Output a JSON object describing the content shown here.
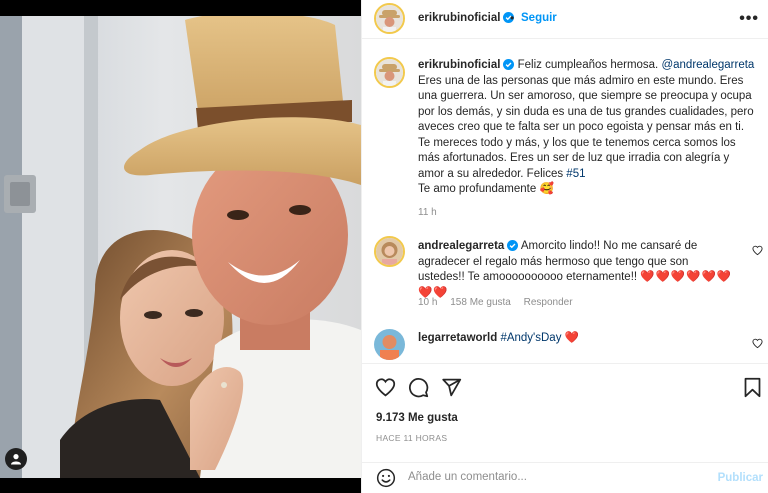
{
  "header": {
    "username": "erikrubinoficial",
    "dot": "•",
    "follow_label": "Seguir",
    "more_label": "•••"
  },
  "caption": {
    "username": "erikrubinoficial",
    "text_before_mention": "Feliz cumpleaños hermosa. ",
    "mention": "@andrealegarreta",
    "text_body": " Eres una de las personas que más admiro en este mundo. Eres una guerrera. Un ser amoroso, que siempre se preocupa y ocupa por los demás, y sin duda es una de tus grandes cualidades, pero aveces creo que te falta ser un poco egoista y pensar más en ti. Te mereces todo y más, y los que te tenemos cerca somos los más afortunados. Eres un ser de luz que irradia con alegría y amor a su alrededor. Felices ",
    "hashtag": "#51",
    "closing": "Te amo profundamente",
    "closing_emoji": "🥰",
    "time": "11 h"
  },
  "comments": [
    {
      "username": "andrealegarreta",
      "text": "Amorcito lindo!! No me cansaré de agradecer el regalo más hermoso que tengo que son ustedes!! Te amoooooooooo eternamente!!",
      "hearts": "❤️❤️❤️❤️❤️❤️❤️❤️",
      "time": "10 h",
      "likes": "158 Me gusta",
      "reply_label": "Responder"
    },
    {
      "username": "legarretaworld",
      "hashtag": "#Andy'sDay",
      "hearts": "❤️"
    }
  ],
  "actions": {
    "likes": "9.173 Me gusta",
    "ago": "HACE 11 HORAS"
  },
  "add_comment": {
    "placeholder": "Añade un comentario...",
    "publish_label": "Publicar"
  },
  "icons": [
    "verified-badge-icon",
    "heart-icon",
    "comment-icon",
    "share-icon",
    "bookmark-icon",
    "emoji-icon",
    "user-tag-icon",
    "more-options-icon"
  ],
  "colors": {
    "link": "#0095f6",
    "mention": "#00376b",
    "secondary": "#8e8e8e",
    "heart": "#ed4956",
    "publish_disabled": "#b2dffc"
  }
}
